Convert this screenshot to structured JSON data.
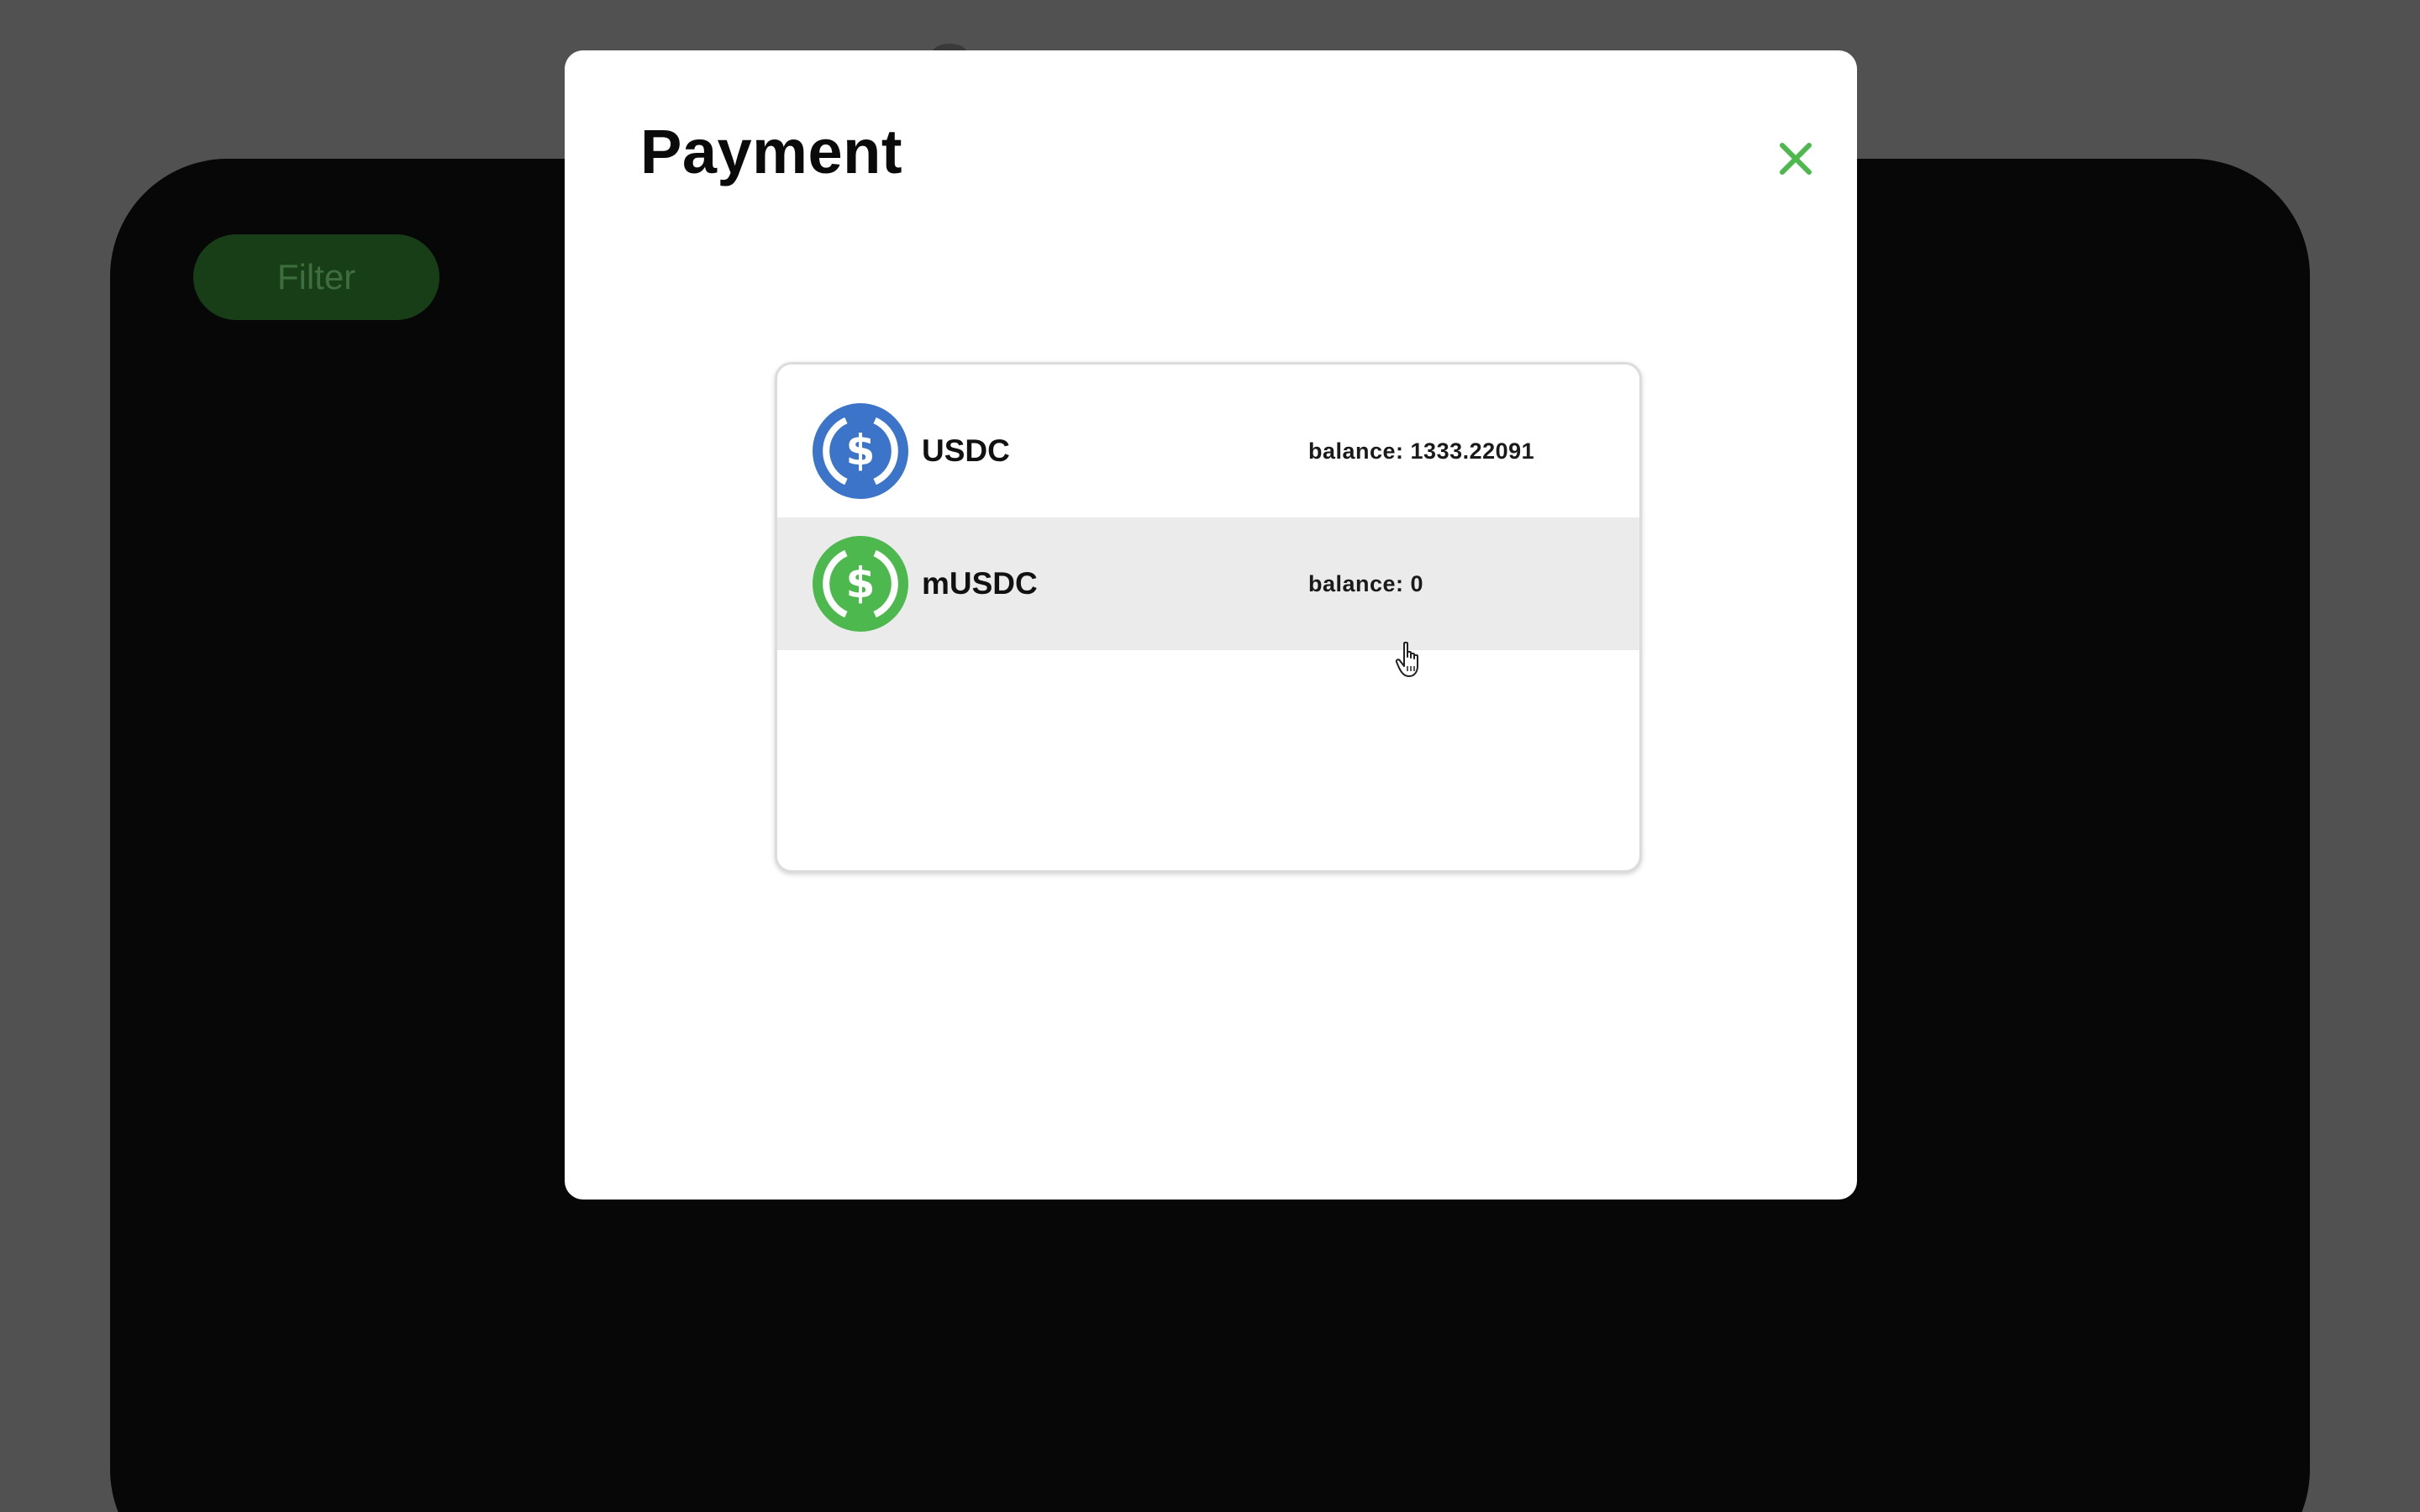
{
  "background": {
    "filter_label": "Filter"
  },
  "modal": {
    "title": "Payment",
    "close_icon": "close-icon",
    "tokens": [
      {
        "name": "USDC",
        "balance": "balance: 1333.22091",
        "icon": "usdc-coin-icon",
        "color": "#3b74c8"
      },
      {
        "name": "mUSDC",
        "balance": "balance: 0",
        "icon": "musdc-coin-icon",
        "color": "#4db84d"
      }
    ]
  },
  "colors": {
    "accent": "#4db84d",
    "overlay": "#515151",
    "hover_row": "#ebebeb"
  }
}
